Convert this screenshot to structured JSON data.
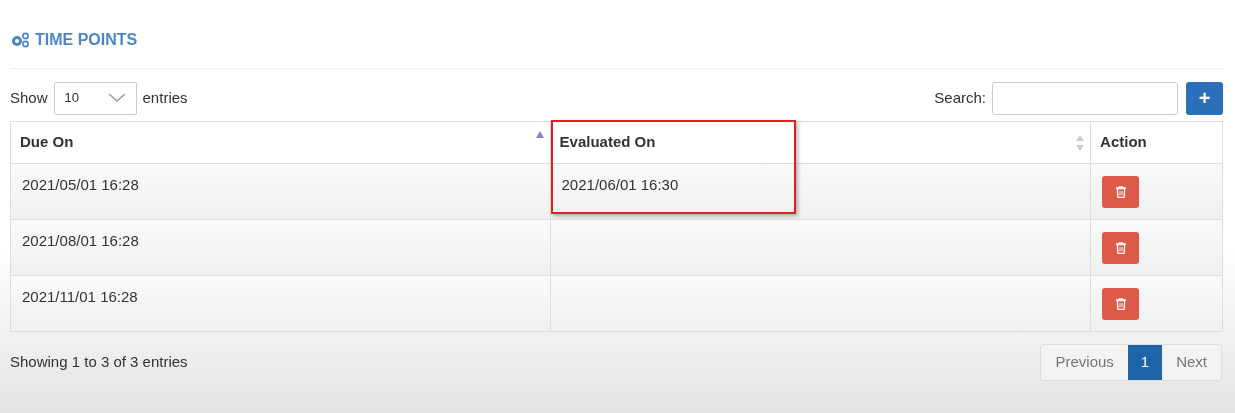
{
  "title": "TIME POINTS",
  "length_menu": {
    "before": "Show",
    "value": "10",
    "after": "entries"
  },
  "search": {
    "label": "Search:",
    "add_button": "+"
  },
  "table": {
    "columns": [
      {
        "label": "Due On",
        "sortable": true,
        "sorted_ascending": true,
        "highlighted": false
      },
      {
        "label": "Evaluated On",
        "sortable": true,
        "sorted_ascending": false,
        "highlighted": true
      },
      {
        "label": "Action",
        "sortable": false,
        "highlighted": false
      }
    ],
    "rows": [
      {
        "due_on": "2021/05/01 16:28",
        "evaluated_on": "2021/06/01 16:30"
      },
      {
        "due_on": "2021/08/01 16:28"
      },
      {
        "due_on": "2021/11/01 16:28"
      }
    ]
  },
  "info": "Showing 1 to 3 of 3 entries",
  "pagination": {
    "previous": "Previous",
    "pages": [
      {
        "label": "1",
        "selected": true
      }
    ],
    "next": "Next"
  }
}
